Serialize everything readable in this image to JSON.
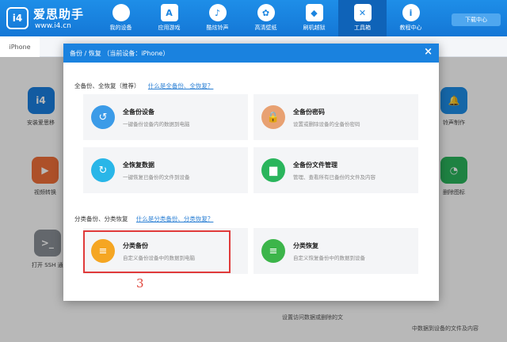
{
  "app": {
    "logo_text": "i4",
    "brand_name": "爱思助手",
    "brand_url": "www.i4.cn",
    "download_label": "下载中心"
  },
  "nav": [
    {
      "label": "我的设备",
      "icon": "apple-icon",
      "glyph": ""
    },
    {
      "label": "应用游戏",
      "icon": "app-store-icon",
      "glyph": "A"
    },
    {
      "label": "酷炫铃声",
      "icon": "bell-icon",
      "glyph": "♪"
    },
    {
      "label": "高清壁纸",
      "icon": "flower-icon",
      "glyph": "✿"
    },
    {
      "label": "刷机越狱",
      "icon": "dropbox-icon",
      "glyph": "◆"
    },
    {
      "label": "工具箱",
      "icon": "tools-icon",
      "glyph": "✕"
    },
    {
      "label": "教程中心",
      "icon": "info-icon",
      "glyph": "i"
    }
  ],
  "device_tab": "iPhone",
  "background_tools": [
    {
      "label": "安装爱思移",
      "glyph": "i4",
      "color": "#1a7fe0"
    },
    {
      "label": "视频转换",
      "glyph": "▶",
      "color": "#f0703a"
    },
    {
      "label": "打开 SSH 通",
      "glyph": ">_",
      "color": "#8a8f96"
    },
    {
      "label": "铃声制作",
      "glyph": "🔔",
      "color": "#1e8ee8"
    },
    {
      "label": "删除图标",
      "glyph": "◔",
      "color": "#2ab55c"
    }
  ],
  "background_text": {
    "line1": "设置访问数据或删除的文",
    "line2": "中数据到设备的文件及内容"
  },
  "dialog": {
    "title": "备份 / 恢复 （当前设备：iPhone）",
    "close": "×",
    "section1": {
      "title": "全备份、全恢复（推荐）",
      "link": "什么是全备份、全恢复？"
    },
    "section2": {
      "title": "分类备份、分类恢复",
      "link": "什么是分类备份、分类恢复？"
    },
    "cards": [
      {
        "title": "全备份设备",
        "desc": "一键备份设备内的数据到电脑",
        "icon": "full-backup-icon",
        "glyph": "↺",
        "color": "#3b9be8"
      },
      {
        "title": "全备份密码",
        "desc": "设置或删除设备的全备份密码",
        "icon": "lock-icon",
        "glyph": "🔒",
        "color": "#e8a172"
      },
      {
        "title": "全恢复数据",
        "desc": "一键恢复已备份的文件到设备",
        "icon": "restore-icon",
        "glyph": "↻",
        "color": "#29b6e8"
      },
      {
        "title": "全备份文件管理",
        "desc": "管理、查看所有已备份的文件及内容",
        "icon": "folder-icon",
        "glyph": "▆",
        "color": "#2ab55c"
      },
      {
        "title": "分类备份",
        "desc": "自定义备份设备中的数据到电脑",
        "icon": "category-backup-icon",
        "glyph": "≡",
        "color": "#f5a623"
      },
      {
        "title": "分类恢复",
        "desc": "自定义恢复备份中的数据到设备",
        "icon": "category-restore-icon",
        "glyph": "≡",
        "color": "#3cb54a"
      }
    ]
  },
  "annotation": "3",
  "colors": {
    "primary": "#1a82df",
    "highlight": "#e03a3a"
  }
}
